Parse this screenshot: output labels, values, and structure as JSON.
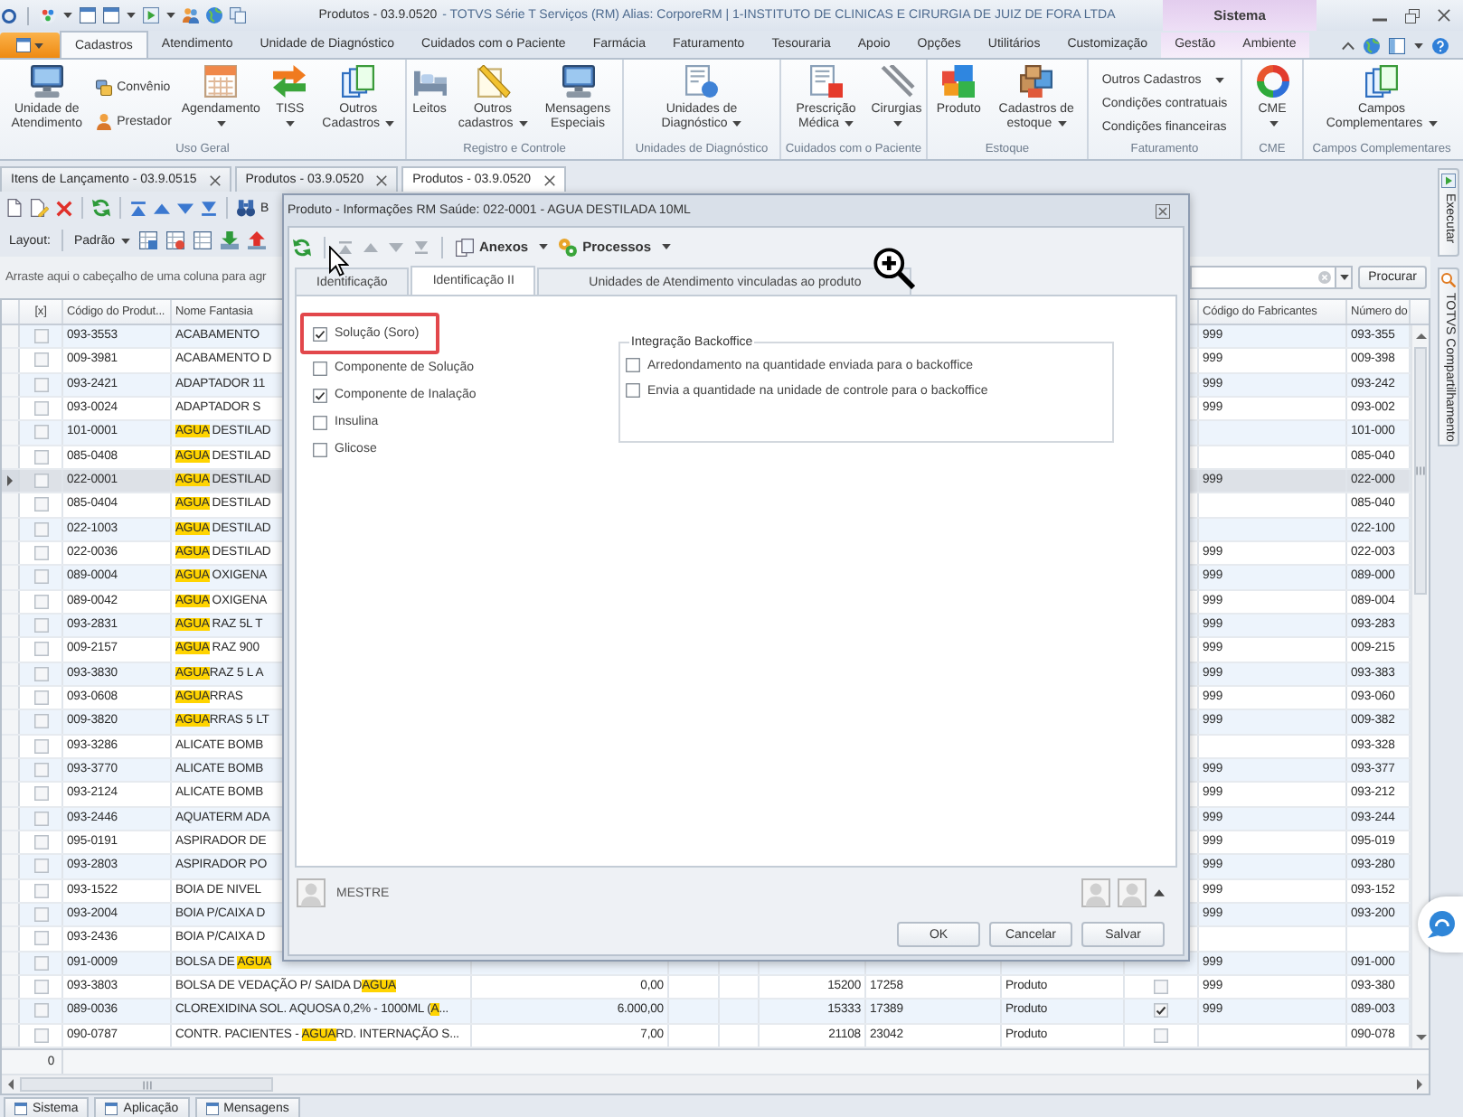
{
  "title_bar": {
    "document": "Produtos - 03.9.0520",
    "application": "- TOTVS Série T Serviços (RM) Alias: CorporeRM | 1-INSTITUTO DE CLINICAS E CIRURGIA DE JUIZ DE FORA LTDA",
    "context_label": "Sistema"
  },
  "ribbon": {
    "tabs": [
      {
        "label": "Cadastros",
        "selected": true,
        "context": false
      },
      {
        "label": "Atendimento",
        "selected": false,
        "context": false
      },
      {
        "label": "Unidade de Diagnóstico",
        "selected": false,
        "context": false
      },
      {
        "label": "Cuidados com o Paciente",
        "selected": false,
        "context": false
      },
      {
        "label": "Farmácia",
        "selected": false,
        "context": false
      },
      {
        "label": "Faturamento",
        "selected": false,
        "context": false
      },
      {
        "label": "Tesouraria",
        "selected": false,
        "context": false
      },
      {
        "label": "Apoio",
        "selected": false,
        "context": false
      },
      {
        "label": "Opções",
        "selected": false,
        "context": false
      },
      {
        "label": "Utilitários",
        "selected": false,
        "context": false
      },
      {
        "label": "Customização",
        "selected": false,
        "context": false
      },
      {
        "label": "Gestão",
        "selected": false,
        "context": true
      },
      {
        "label": "Ambiente",
        "selected": false,
        "context": true
      }
    ],
    "groups": [
      {
        "label": "Uso Geral",
        "items": [
          {
            "kind": "large",
            "label": "Unidade de Atendimento",
            "dropdown": false
          },
          {
            "kind": "stack",
            "entries": [
              {
                "label": "Convênio",
                "dropdown": false
              },
              {
                "label": "Prestador",
                "dropdown": false
              }
            ]
          },
          {
            "kind": "large",
            "label": "Agendamento",
            "dropdown": true
          },
          {
            "kind": "large",
            "label": "TISS",
            "dropdown": true
          },
          {
            "kind": "large",
            "label": "Outros Cadastros",
            "dropdown": true
          }
        ]
      },
      {
        "label": "Registro e Controle",
        "items": [
          {
            "kind": "large",
            "label": "Leitos",
            "dropdown": false
          },
          {
            "kind": "large",
            "label": "Outros cadastros",
            "dropdown": true
          },
          {
            "kind": "large",
            "label": "Mensagens Especiais",
            "dropdown": false
          }
        ]
      },
      {
        "label": "Unidades de Diagnóstico",
        "items": [
          {
            "kind": "large",
            "label": "Unidades de Diagnóstico",
            "dropdown": true
          }
        ]
      },
      {
        "label": "Cuidados com o Paciente",
        "items": [
          {
            "kind": "large",
            "label": "Prescrição Médica",
            "dropdown": true
          },
          {
            "kind": "large",
            "label": "Cirurgias",
            "dropdown": true
          }
        ]
      },
      {
        "label": "Estoque",
        "items": [
          {
            "kind": "large",
            "label": "Produto",
            "dropdown": false
          },
          {
            "kind": "large",
            "label": "Cadastros de estoque",
            "dropdown": true
          }
        ]
      },
      {
        "label": "Faturamento",
        "items": [
          {
            "kind": "list",
            "entries": [
              {
                "label": "Outros Cadastros",
                "dropdown": true
              },
              {
                "label": "Condições contratuais",
                "dropdown": false
              },
              {
                "label": "Condições financeiras",
                "dropdown": false
              }
            ]
          }
        ]
      },
      {
        "label": "CME",
        "items": [
          {
            "kind": "large",
            "label": "CME",
            "dropdown": true
          }
        ]
      },
      {
        "label": "Campos Complementares",
        "items": [
          {
            "kind": "large",
            "label": "Campos Complementares",
            "dropdown": true
          }
        ]
      }
    ]
  },
  "document_tabs": [
    {
      "label": "Itens de Lançamento - 03.9.0515",
      "selected": false
    },
    {
      "label": "Produtos - 03.9.0520",
      "selected": false
    },
    {
      "label": "Produtos - 03.9.0520",
      "selected": true
    }
  ],
  "toolbar": {
    "search_label": "B"
  },
  "layout_bar": {
    "label": "Layout:",
    "value": "Padrão"
  },
  "group_panel": {
    "hint": "Arraste aqui o cabeçalho de uma coluna para agr",
    "search_button": "Procurar"
  },
  "grid": {
    "columns": {
      "check": "[x]",
      "code": "Código do Produt...",
      "name": "Nome Fantasia",
      "manufacturer_code": "Código do Fabricantes",
      "number": "Número do"
    },
    "rows": [
      {
        "selected": false,
        "checked": false,
        "code": "093-3553",
        "name": [
          {
            "text": "ACABAMENTO",
            "highlight": false
          }
        ],
        "manufacturer_code": "999",
        "number": "093-355"
      },
      {
        "selected": false,
        "checked": false,
        "code": "009-3981",
        "name": [
          {
            "text": "ACABAMENTO D",
            "highlight": false
          }
        ],
        "manufacturer_code": "999",
        "number": "009-398"
      },
      {
        "selected": false,
        "checked": false,
        "code": "093-2421",
        "name": [
          {
            "text": "ADAPTADOR 11",
            "highlight": false
          }
        ],
        "manufacturer_code": "999",
        "number": "093-242"
      },
      {
        "selected": false,
        "checked": false,
        "code": "093-0024",
        "name": [
          {
            "text": "ADAPTADOR S",
            "highlight": false
          }
        ],
        "manufacturer_code": "999",
        "number": "093-002"
      },
      {
        "selected": false,
        "checked": false,
        "code": "101-0001",
        "name": [
          {
            "text": "AGUA",
            "highlight": true
          },
          {
            "text": " DESTILAD",
            "highlight": false
          }
        ],
        "number": "101-000"
      },
      {
        "selected": false,
        "checked": false,
        "code": "085-0408",
        "name": [
          {
            "text": "AGUA",
            "highlight": true
          },
          {
            "text": " DESTILAD",
            "highlight": false
          }
        ],
        "number": "085-040"
      },
      {
        "selected": true,
        "checked": false,
        "code": "022-0001",
        "name": [
          {
            "text": "AGUA",
            "highlight": true
          },
          {
            "text": " DESTILAD",
            "highlight": false
          }
        ],
        "manufacturer_code": "999",
        "number": "022-000"
      },
      {
        "selected": false,
        "checked": false,
        "code": "085-0404",
        "name": [
          {
            "text": "AGUA",
            "highlight": true
          },
          {
            "text": " DESTILAD",
            "highlight": false
          }
        ],
        "number": "085-040"
      },
      {
        "selected": false,
        "checked": false,
        "code": "022-1003",
        "name": [
          {
            "text": "AGUA",
            "highlight": true
          },
          {
            "text": " DESTILAD",
            "highlight": false
          }
        ],
        "number": "022-100"
      },
      {
        "selected": false,
        "checked": false,
        "code": "022-0036",
        "name": [
          {
            "text": "AGUA",
            "highlight": true
          },
          {
            "text": " DESTILAD",
            "highlight": false
          }
        ],
        "manufacturer_code": "999",
        "number": "022-003"
      },
      {
        "selected": false,
        "checked": false,
        "code": "089-0004",
        "name": [
          {
            "text": "AGUA",
            "highlight": true
          },
          {
            "text": " OXIGENA",
            "highlight": false
          }
        ],
        "manufacturer_code": "999",
        "number": "089-000"
      },
      {
        "selected": false,
        "checked": false,
        "code": "089-0042",
        "name": [
          {
            "text": "AGUA",
            "highlight": true
          },
          {
            "text": " OXIGENA",
            "highlight": false
          }
        ],
        "manufacturer_code": "999",
        "number": "089-004"
      },
      {
        "selected": false,
        "checked": false,
        "code": "093-2831",
        "name": [
          {
            "text": "AGUA",
            "highlight": true
          },
          {
            "text": " RAZ 5L T",
            "highlight": false
          }
        ],
        "manufacturer_code": "999",
        "number": "093-283"
      },
      {
        "selected": false,
        "checked": false,
        "code": "009-2157",
        "name": [
          {
            "text": "AGUA",
            "highlight": true
          },
          {
            "text": " RAZ 900",
            "highlight": false
          }
        ],
        "manufacturer_code": "999",
        "number": "009-215"
      },
      {
        "selected": false,
        "checked": false,
        "code": "093-3830",
        "name": [
          {
            "text": "AGUA",
            "highlight": true
          },
          {
            "text": "RAZ 5 L A",
            "highlight": false
          }
        ],
        "manufacturer_code": "999",
        "number": "093-383"
      },
      {
        "selected": false,
        "checked": false,
        "code": "093-0608",
        "name": [
          {
            "text": "AGUA",
            "highlight": true
          },
          {
            "text": "RRAS",
            "highlight": false
          }
        ],
        "manufacturer_code": "999",
        "number": "093-060"
      },
      {
        "selected": false,
        "checked": false,
        "code": "009-3820",
        "name": [
          {
            "text": "AGUA",
            "highlight": true
          },
          {
            "text": "RRAS 5 LT",
            "highlight": false
          }
        ],
        "manufacturer_code": "999",
        "number": "009-382"
      },
      {
        "selected": false,
        "checked": false,
        "code": "093-3286",
        "name": [
          {
            "text": "ALICATE BOMB",
            "highlight": false
          }
        ],
        "number": "093-328"
      },
      {
        "selected": false,
        "checked": false,
        "code": "093-3770",
        "name": [
          {
            "text": "ALICATE BOMB",
            "highlight": false
          }
        ],
        "manufacturer_code": "999",
        "number": "093-377"
      },
      {
        "selected": false,
        "checked": false,
        "code": "093-2124",
        "name": [
          {
            "text": "ALICATE BOMB",
            "highlight": false
          }
        ],
        "manufacturer_code": "999",
        "number": "093-212"
      },
      {
        "selected": false,
        "checked": false,
        "code": "093-2446",
        "name": [
          {
            "text": "AQUATERM ADA",
            "highlight": false
          }
        ],
        "manufacturer_code": "999",
        "number": "093-244"
      },
      {
        "selected": false,
        "checked": false,
        "code": "095-0191",
        "name": [
          {
            "text": "ASPIRADOR DE",
            "highlight": false
          }
        ],
        "manufacturer_code": "999",
        "number": "095-019"
      },
      {
        "selected": false,
        "checked": false,
        "code": "093-2803",
        "name": [
          {
            "text": "ASPIRADOR PO",
            "highlight": false
          }
        ],
        "manufacturer_code": "999",
        "number": "093-280"
      },
      {
        "selected": false,
        "checked": false,
        "code": "093-1522",
        "name": [
          {
            "text": "BOIA DE NIVEL",
            "highlight": false
          }
        ],
        "manufacturer_code": "999",
        "number": "093-152"
      },
      {
        "selected": false,
        "checked": false,
        "code": "093-2004",
        "name": [
          {
            "text": "BOIA P/CAIXA D",
            "highlight": false
          }
        ],
        "manufacturer_code": "999",
        "number": "093-200"
      },
      {
        "selected": false,
        "checked": false,
        "code": "093-2436",
        "name": [
          {
            "text": "BOIA P/CAIXA D",
            "highlight": false
          }
        ]
      },
      {
        "selected": false,
        "checked": false,
        "code": "091-0009",
        "name": [
          {
            "text": "BOLSA DE ",
            "highlight": false
          },
          {
            "text": "AGUA",
            "highlight": true
          }
        ],
        "manufacturer_code": "999",
        "number": "091-000"
      },
      {
        "selected": false,
        "checked": false,
        "code": "093-3803",
        "name": [
          {
            "text": "BOLSA DE VEDAÇÃO P/ SAIDA D",
            "highlight": false
          },
          {
            "text": "AGUA",
            "highlight": true
          }
        ],
        "column_5": "0,00",
        "column_8": "15200",
        "column_9": "17258",
        "column_10": "Produto",
        "column_11": false,
        "manufacturer_code": "999",
        "number": "093-380"
      },
      {
        "selected": false,
        "checked": false,
        "code": "089-0036",
        "name": [
          {
            "text": "CLOREXIDINA SOL. AQUOSA 0,2% - 1000ML (",
            "highlight": false
          },
          {
            "text": "A",
            "highlight": true
          },
          {
            "text": "...",
            "highlight": false
          }
        ],
        "column_5": "6.000,00",
        "column_8": "15333",
        "column_9": "17389",
        "column_10": "Produto",
        "column_11": true,
        "manufacturer_code": "999",
        "number": "089-003"
      },
      {
        "selected": false,
        "checked": false,
        "code": "090-0787",
        "name": [
          {
            "text": "CONTR. PACIENTES - ",
            "highlight": false
          },
          {
            "text": "AGUA",
            "highlight": true
          },
          {
            "text": "RD. INTERNAÇÃO S...",
            "highlight": false
          }
        ],
        "column_5": "7,00",
        "column_8": "21108",
        "column_9": "23042",
        "column_10": "Produto",
        "column_11": false,
        "number": "090-078"
      }
    ],
    "footer": {
      "count": "0"
    }
  },
  "status_tabs": [
    {
      "label": "Sistema"
    },
    {
      "label": "Aplicação"
    },
    {
      "label": "Mensagens"
    }
  ],
  "side_panels": [
    {
      "label": "Executar"
    },
    {
      "label": "TOTVS Compartilhamento"
    }
  ],
  "dialog": {
    "title": "Produto - Informações RM Saúde: 022-0001 - AGUA DESTILADA 10ML",
    "toolbar": {
      "navigation_disabled": true,
      "attachments": "Anexos",
      "processes": "Processos"
    },
    "tabs": [
      {
        "label": "Identificação",
        "selected": false
      },
      {
        "label": "Identificação II",
        "selected": true
      },
      {
        "label": "Unidades de Atendimento vinculadas ao produto",
        "selected": false
      }
    ],
    "options": [
      {
        "label": "Solução (Soro)",
        "checked": true,
        "highlighted": true
      },
      {
        "label": "Componente de Solução",
        "checked": false,
        "highlighted": false
      },
      {
        "label": "Componente de Inalação",
        "checked": true,
        "highlighted": false
      },
      {
        "label": "Insulina",
        "checked": false,
        "highlighted": false
      },
      {
        "label": "Glicose",
        "checked": false,
        "highlighted": false
      }
    ],
    "backoffice": {
      "title": "Integração Backoffice",
      "options": [
        {
          "label": "Arredondamento na quantidade enviada para o backoffice",
          "checked": false
        },
        {
          "label": "Envia a quantidade na unidade de controle para o backoffice",
          "checked": false
        }
      ]
    },
    "user": "MESTRE",
    "buttons": [
      "OK",
      "Cancelar",
      "Salvar"
    ]
  }
}
